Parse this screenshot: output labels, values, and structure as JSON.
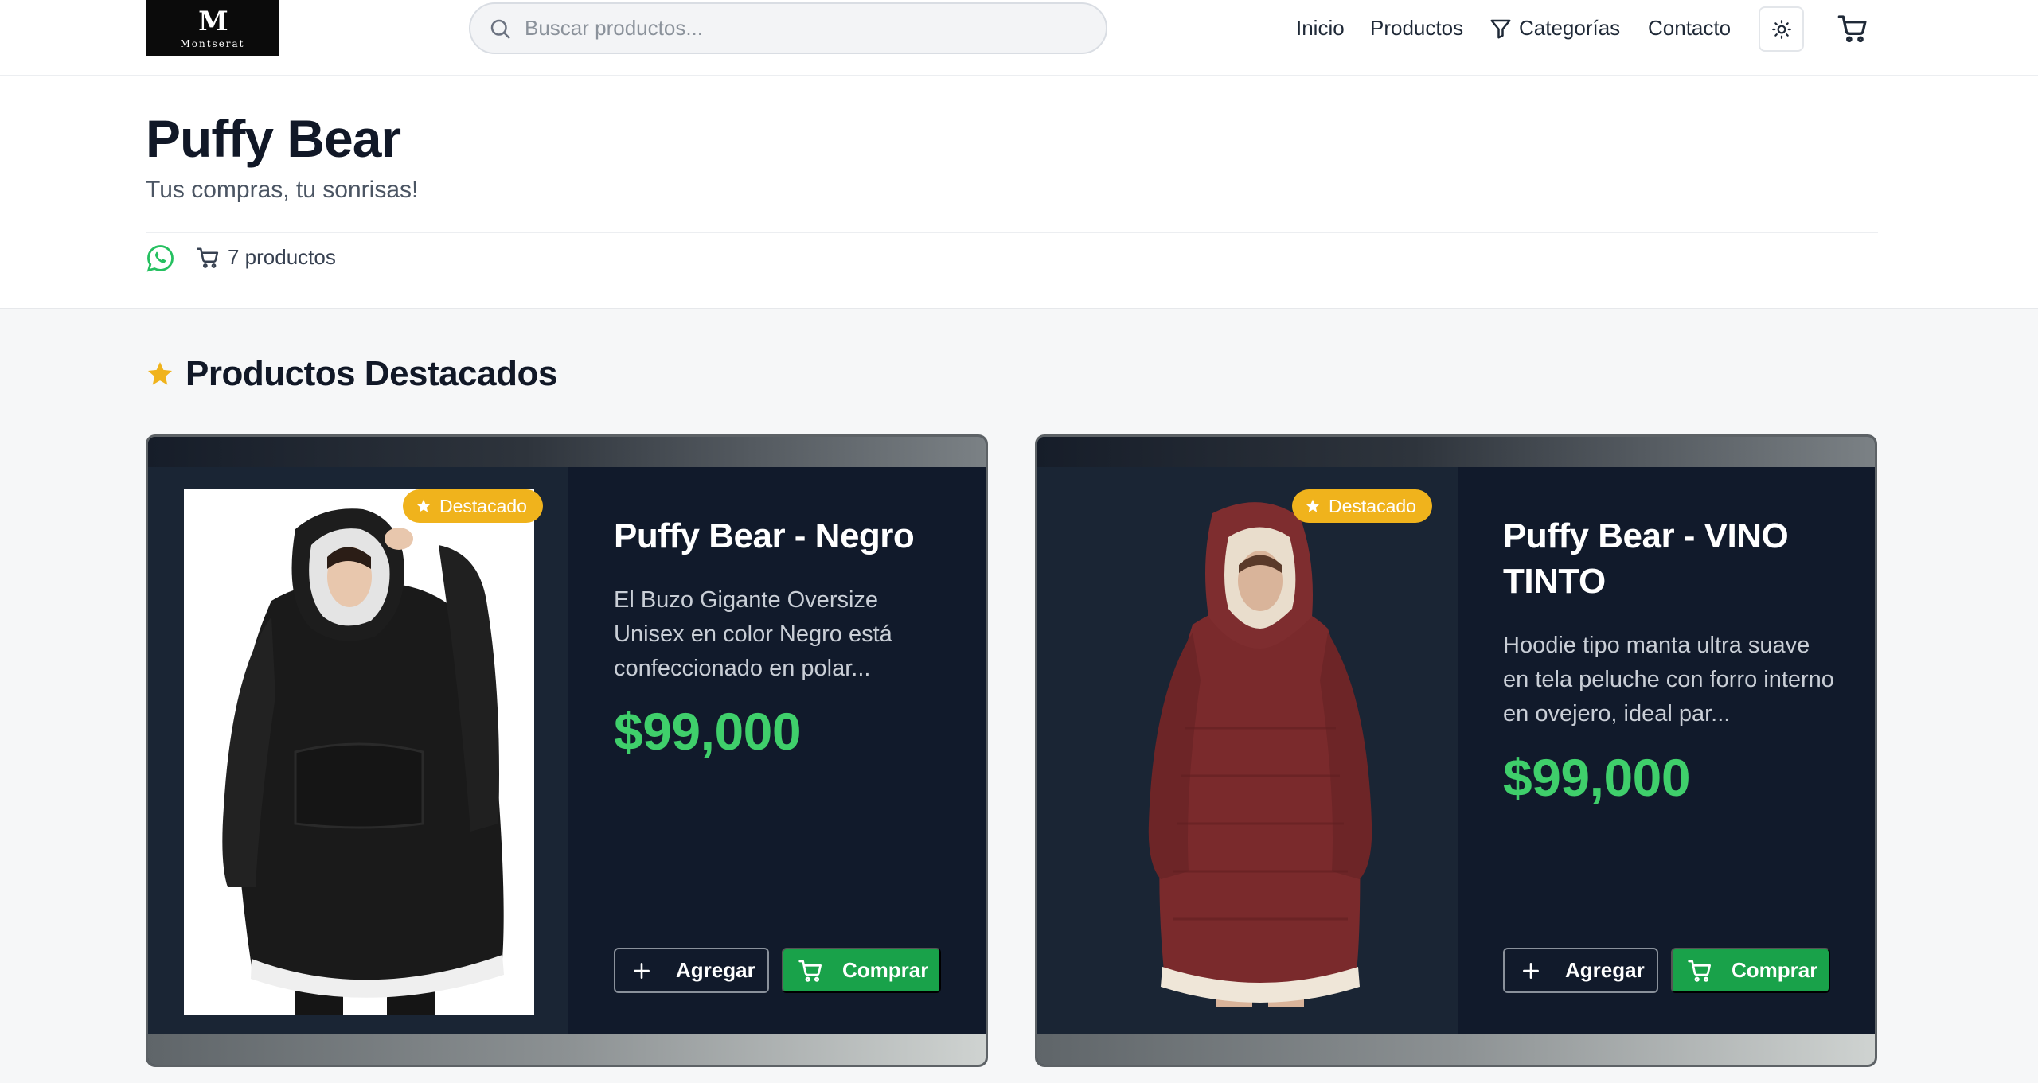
{
  "header": {
    "logo_text": "Montserat",
    "search_placeholder": "Buscar productos...",
    "nav": {
      "inicio": "Inicio",
      "productos": "Productos",
      "categorias": "Categorías",
      "contacto": "Contacto"
    }
  },
  "store": {
    "title": "Puffy Bear",
    "subtitle": "Tus compras, tu sonrisas!",
    "product_count": "7 productos"
  },
  "featured": {
    "heading": "Productos Destacados",
    "products": [
      {
        "badge": "Destacado",
        "title": "Puffy Bear - Negro",
        "description": "El Buzo Gigante Oversize Unisex en color Negro está confeccionado en polar...",
        "price": "$99,000",
        "add_label": "Agregar",
        "buy_label": "Comprar",
        "garment_color": "#111111"
      },
      {
        "badge": "Destacado",
        "title": "Puffy Bear - VINO TINTO",
        "description": "Hoodie tipo manta ultra suave en tela peluche con forro interno en ovejero, ideal par...",
        "price": "$99,000",
        "add_label": "Agregar",
        "buy_label": "Comprar",
        "garment_color": "#7a2a2c"
      }
    ]
  },
  "colors": {
    "accent_green": "#3fcf6b",
    "buy_button": "#19a24a",
    "badge": "#f0b31c",
    "card_bg": "#111a2b",
    "whatsapp": "#25c060"
  }
}
